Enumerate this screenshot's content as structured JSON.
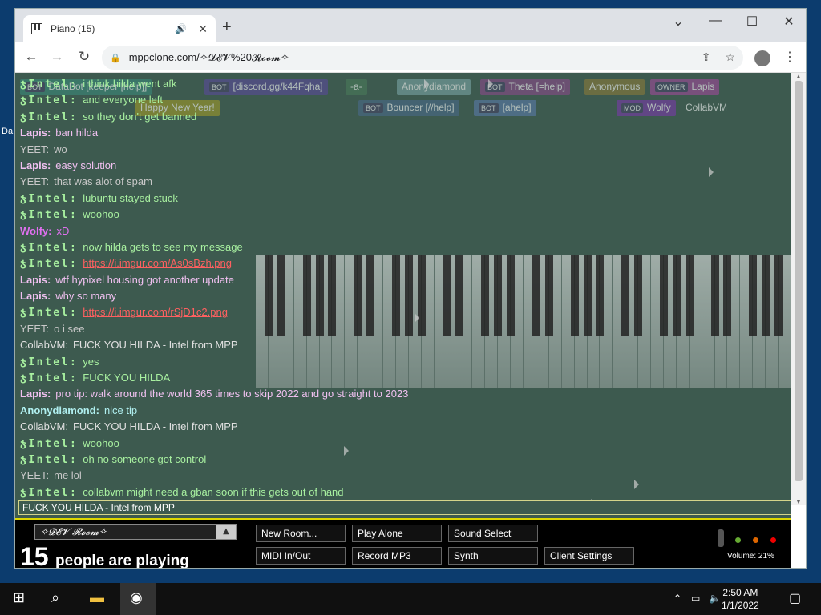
{
  "desktop": {
    "label": "Da"
  },
  "browser": {
    "tab_title": "Piano (15)",
    "url": "mppclone.com/✧𝓓𝓔𝓥%20𝓡𝓸𝓸𝓶✧"
  },
  "nametags": [
    {
      "badge": "BOT",
      "label": "DataBot [keeper [help]]",
      "color": "#3a8a7a"
    },
    {
      "badge": "BOT",
      "label": "[discord.gg/k44Fqha]",
      "color": "#5a4a9a"
    },
    {
      "badge": "",
      "label": "-a-",
      "color": "#4a7a5a"
    },
    {
      "badge": "",
      "label": "Anonydiamond",
      "color": "#7aa4a4"
    },
    {
      "badge": "BOT",
      "label": "Theta [=help]",
      "color": "#8a4a8a"
    },
    {
      "badge": "",
      "label": "Anonymous",
      "color": "#8a7a3a"
    },
    {
      "badge": "OWNER",
      "label": "Lapis",
      "color": "#a04a9a"
    },
    {
      "badge": "",
      "label": "Happy New Year!",
      "color": "#a09a2a"
    },
    {
      "badge": "BOT",
      "label": "Bouncer [//help]",
      "color": "#4a6a8a"
    },
    {
      "badge": "BOT",
      "label": "[ahelp]",
      "color": "#5a7aaa"
    },
    {
      "badge": "MOD",
      "label": "Wolfy",
      "color": "#7a3aaa"
    },
    {
      "badge": "",
      "label": "CollabVM",
      "color": "#3d5a4f"
    }
  ],
  "chat": [
    {
      "nick": "ჯIntel:",
      "cls": "intel",
      "text": "i think hilda went afk"
    },
    {
      "nick": "ჯIntel:",
      "cls": "intel",
      "text": "and everyone left"
    },
    {
      "nick": "ჯIntel:",
      "cls": "intel",
      "text": "so they don't get banned"
    },
    {
      "nick": "Lapis:",
      "cls": "lapis",
      "text": "ban hilda"
    },
    {
      "nick": "YEET:",
      "cls": "yeet",
      "text": "wo"
    },
    {
      "nick": "Lapis:",
      "cls": "lapis",
      "text": "easy solution"
    },
    {
      "nick": "YEET:",
      "cls": "yeet",
      "text": "that was alot of spam"
    },
    {
      "nick": "ჯIntel:",
      "cls": "intel",
      "text": "lubuntu stayed stuck"
    },
    {
      "nick": "ჯIntel:",
      "cls": "intel",
      "text": "woohoo"
    },
    {
      "nick": "Wolfy:",
      "cls": "wolfy",
      "text": "xD"
    },
    {
      "nick": "ჯIntel:",
      "cls": "intel",
      "text": "now hilda gets to see my message"
    },
    {
      "nick": "ჯIntel:",
      "cls": "link",
      "text": "https://i.imgur.com/As0sBzh.png"
    },
    {
      "nick": "Lapis:",
      "cls": "lapis",
      "text": "wtf hypixel housing got another update"
    },
    {
      "nick": "Lapis:",
      "cls": "lapis",
      "text": "why so many"
    },
    {
      "nick": "ჯIntel:",
      "cls": "link",
      "text": "https://i.imgur.com/rSjD1c2.png"
    },
    {
      "nick": "YEET:",
      "cls": "yeet",
      "text": "o i see"
    },
    {
      "nick": "CollabVM:",
      "cls": "collab",
      "text": "FUCK YOU HILDA - Intel from MPP"
    },
    {
      "nick": "ჯIntel:",
      "cls": "intel",
      "text": "yes"
    },
    {
      "nick": "ჯIntel:",
      "cls": "intel",
      "text": "FUCK YOU HILDA"
    },
    {
      "nick": "Lapis:",
      "cls": "lapis",
      "text": "pro tip: walk around the world 365 times to skip 2022 and go straight to 2023"
    },
    {
      "nick": "Anonydiamond:",
      "cls": "anony",
      "text": "nice tip"
    },
    {
      "nick": "CollabVM:",
      "cls": "collab",
      "text": "FUCK YOU HILDA - Intel from MPP"
    },
    {
      "nick": "ჯIntel:",
      "cls": "intel",
      "text": "woohoo"
    },
    {
      "nick": "ჯIntel:",
      "cls": "intel",
      "text": "oh no someone got control"
    },
    {
      "nick": "YEET:",
      "cls": "yeet",
      "text": "me lol"
    },
    {
      "nick": "ჯIntel:",
      "cls": "intel",
      "text": "collabvm might need a gban soon if this gets out of hand"
    }
  ],
  "chat_input": "FUCK YOU HILDA - Intel from MPP",
  "controls": {
    "room": "✧𝓓𝓔𝓥 𝓡𝓸𝓸𝓶✧",
    "count": "15",
    "count_label": "people are playing",
    "buttons": [
      "New Room...",
      "Play Alone",
      "Sound Select",
      "MIDI In/Out",
      "Record MP3",
      "Synth",
      "Client Settings"
    ],
    "volume": "Volume: 21%"
  },
  "taskbar": {
    "time": "2:50 AM",
    "date": "1/1/2022"
  },
  "colors": {
    "page_bg": "#3d5a4f",
    "accent": "#ddd700"
  }
}
